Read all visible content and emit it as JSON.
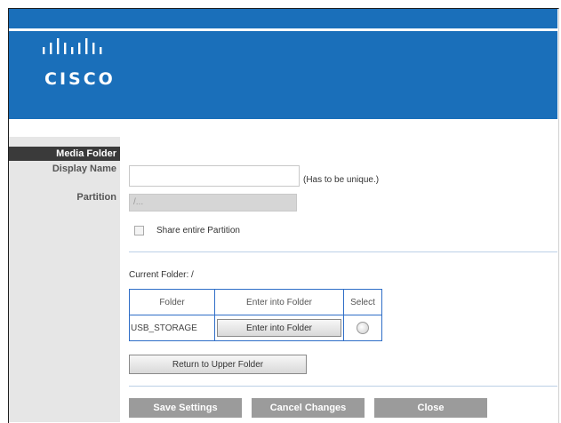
{
  "brand": {
    "name": "CISCO",
    "logo": "cisco-bridge-logo",
    "color": "#1a6fba"
  },
  "sidebar": {
    "section_title": "Media Folder",
    "display_name_label": "Display Name",
    "partition_label": "Partition"
  },
  "form": {
    "display_name_value": "",
    "display_name_hint": "(Has to be unique.)",
    "partition_value": "/...",
    "share_partition_label": "Share entire Partition",
    "share_partition_checked": false,
    "current_folder_label": "Current Folder: /"
  },
  "folder_table": {
    "headers": [
      "Folder",
      "Enter into Folder",
      "Select"
    ],
    "rows": [
      {
        "folder": "USB_STORAGE",
        "enter_button": "Enter into Folder",
        "selected": false
      }
    ]
  },
  "buttons": {
    "return_upper": "Return to Upper Folder",
    "save": "Save Settings",
    "cancel": "Cancel Changes",
    "close": "Close"
  }
}
